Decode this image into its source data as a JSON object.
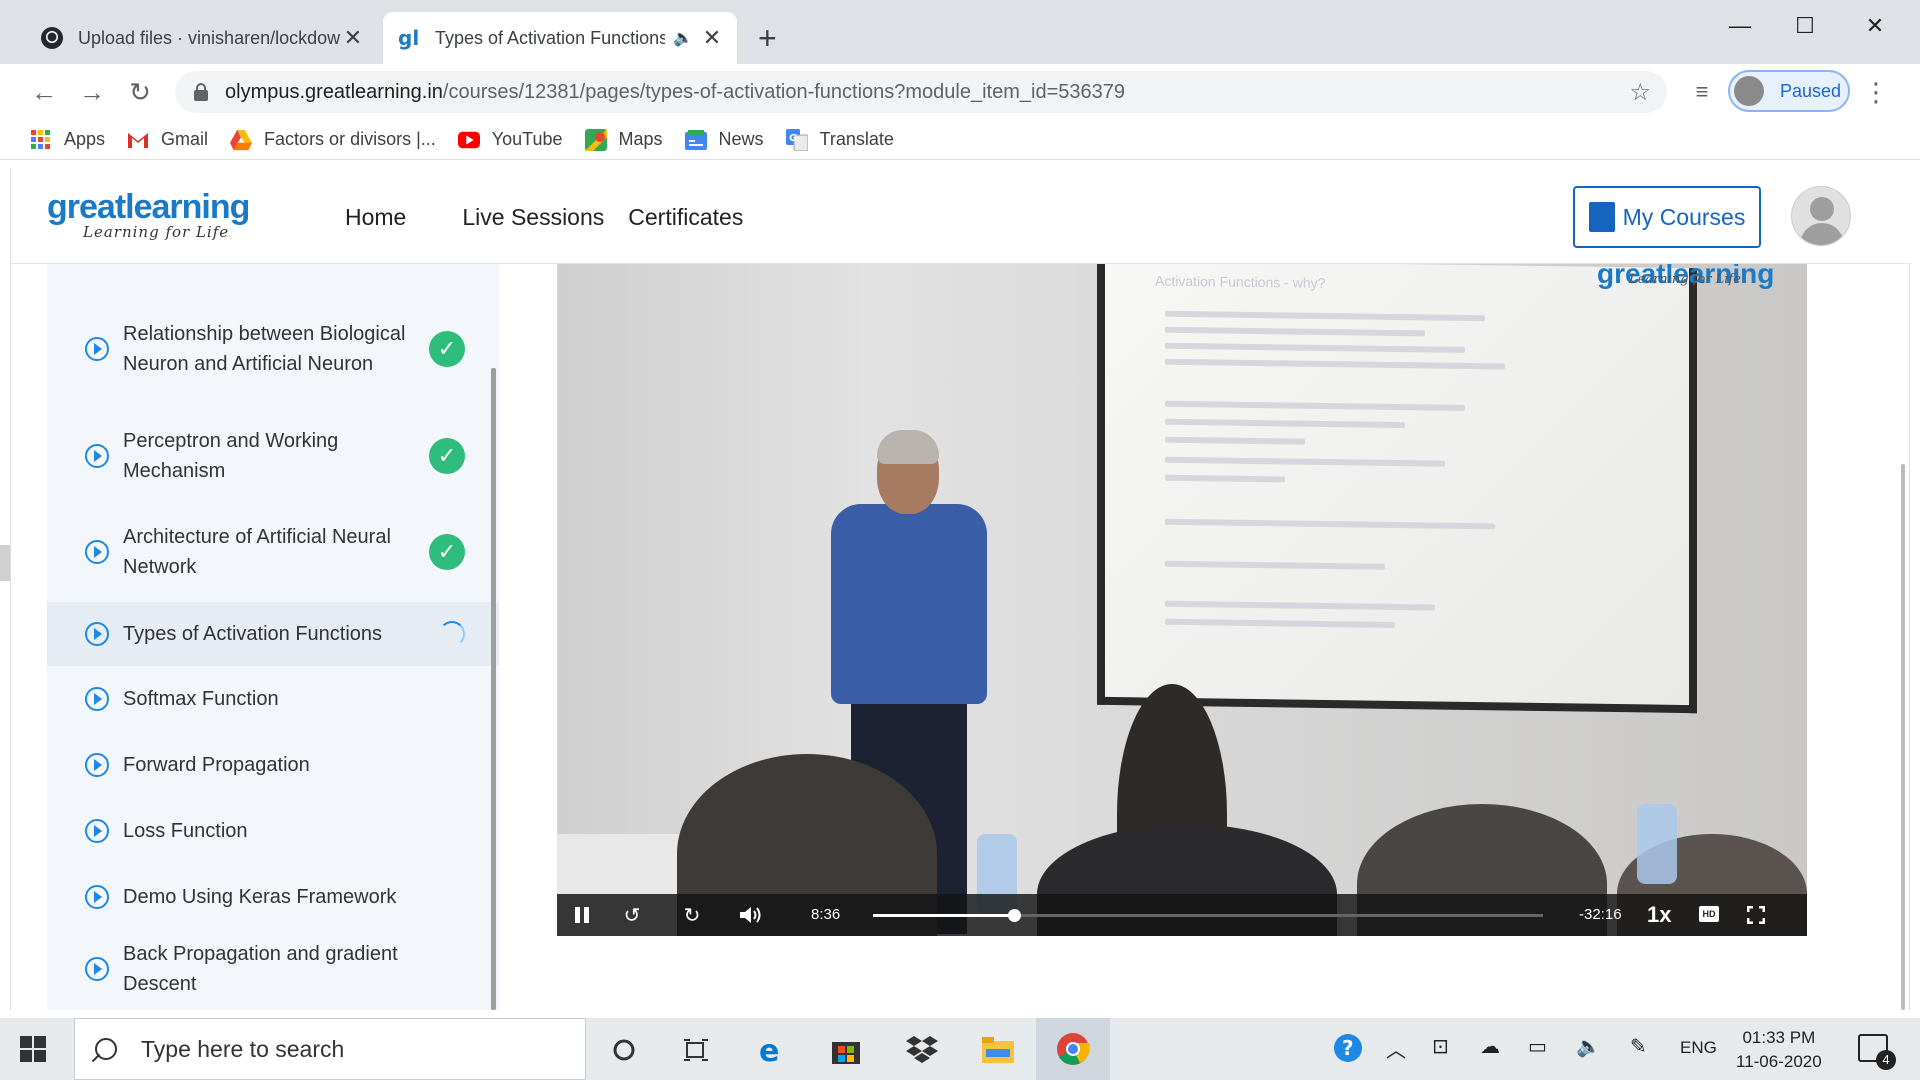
{
  "browser": {
    "tabs": [
      {
        "title": "Upload files · vinisharen/lockdow",
        "icon": "github-icon",
        "active": false
      },
      {
        "title": "Types of Activation Functions",
        "icon": "greatlearning-icon",
        "active": true,
        "audio": true
      }
    ],
    "address": {
      "domain": "olympus.greatlearning.in",
      "path": "/courses/12381/pages/types-of-activation-functions?module_item_id=536379"
    },
    "profile_status": "Paused",
    "bookmarks": [
      {
        "label": "Apps",
        "icon": "apps-grid-icon"
      },
      {
        "label": "Gmail",
        "icon": "gmail-icon"
      },
      {
        "label": "Factors or divisors |...",
        "icon": "drive-icon"
      },
      {
        "label": "YouTube",
        "icon": "youtube-icon"
      },
      {
        "label": "Maps",
        "icon": "maps-icon"
      },
      {
        "label": "News",
        "icon": "news-icon"
      },
      {
        "label": "Translate",
        "icon": "translate-icon"
      }
    ]
  },
  "site": {
    "logo_brand": "greatlearning",
    "logo_tagline": "Learning for Life",
    "nav": [
      "Home",
      "Live Sessions",
      "Certificates"
    ],
    "my_courses": "My Courses"
  },
  "modules": [
    {
      "label": "Relationship between Biological Neuron and Artificial Neuron",
      "status": "done"
    },
    {
      "label": "Perceptron and Working Mechanism",
      "status": "done"
    },
    {
      "label": "Architecture of Artificial Neural Network",
      "status": "done"
    },
    {
      "label": "Types of Activation Functions",
      "status": "loading"
    },
    {
      "label": "Softmax Function",
      "status": ""
    },
    {
      "label": "Forward Propagation",
      "status": ""
    },
    {
      "label": "Loss Function",
      "status": ""
    },
    {
      "label": "Demo Using Keras Framework",
      "status": ""
    },
    {
      "label": "Back Propagation and gradient Descent",
      "status": ""
    }
  ],
  "video": {
    "elapsed": "8:36",
    "remaining": "-32:16",
    "progress_fraction": 0.21,
    "rate": "1x",
    "hd_label": "HD",
    "slide_title": "Activation Functions - why?",
    "overlay_brand": "greatlearning",
    "overlay_tagline": "Learning for Life"
  },
  "taskbar": {
    "search_placeholder": "Type here to search",
    "language": "ENG",
    "time": "01:33 PM",
    "date": "11-06-2020",
    "notifications": "4"
  },
  "colors": {
    "accent": "#1565c0",
    "complete": "#2ebd7c",
    "sidebar_bg": "#f3f7fc"
  }
}
